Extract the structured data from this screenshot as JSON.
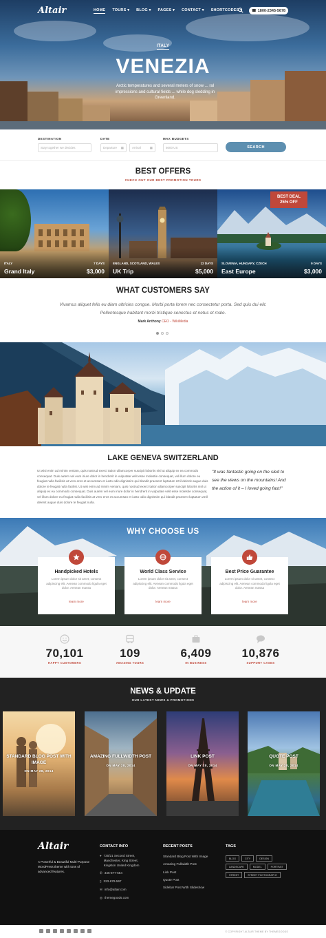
{
  "brand": {
    "logo": "Altair"
  },
  "nav": {
    "items": [
      "HOME",
      "TOURS ▾",
      "BLOG ▾",
      "PAGES ▾",
      "CONTACT ▾",
      "SHORTCODES ▾"
    ],
    "phone": "1800-2345-5678"
  },
  "hero": {
    "tag": "ITALY",
    "title": "VENEZIA",
    "subtitle": "Arctic temperatures and several meters of snow ... ral impressions and cultural fields ... while dog sledding in Greenland."
  },
  "search": {
    "destination_label": "DESTINATION",
    "destination_placeholder": "Stay together we decides",
    "date_label": "DATE",
    "date_from": "Departure",
    "date_to": "Arrival",
    "budget_label": "MAX BUDGETS",
    "budget_placeholder": "5000 US",
    "button": "SEARCH"
  },
  "offers": {
    "title": "BEST OFFERS",
    "subtitle": "CHECK OUT OUR BEST PROMOTION TOURS",
    "items": [
      {
        "region": "ITALY",
        "name": "Grand Italy",
        "days": "7 DAYS",
        "price": "$3,000"
      },
      {
        "region": "ENGLAND, SCOTLAND, WALES",
        "name": "UK Trip",
        "days": "12 DAYS",
        "price": "$5,000"
      },
      {
        "region": "SLOVENIA, HUNGARY, CZECH",
        "name": "East Europe",
        "days": "9 DAYS",
        "price": "$3,000"
      }
    ],
    "deal_badge_line1": "BEST DEAL",
    "deal_badge_line2": "25% OFF"
  },
  "testimonial": {
    "title": "WHAT CUSTOMERS SAY",
    "quote": "Vivamus aliquet felis eu diam ultricies congue. Morbi porta lorem nec consectetur porta. Sed quis dui elit. Pellentesque habitant morbi tristique senectus et netus et male.",
    "author": "Mark Anthony",
    "role": "CEO - WikiMedia"
  },
  "geneva": {
    "title": "LAKE GENEVA SWITZERLAND",
    "body": "Ut wisi enim ad minim veniam, quis nostrud exerci tation ullamcorper suscipit lobortis nisl ut aliquip ex ea commodo consequat. Duis autem vel eum iriure dolor in hendrerit in vulputate velit esse molestie consequat, vel illum dolore eu feugiat nulla facilisis at vero eros et accumsan et iusto odio dignissim qui blandit praesent luptatum zzril delenit augue duis dolore te feugait nulla facilisi. Ut wisi enim ad minim veniam, quis nostrud exerci tation ullamcorper suscipit lobortis nisl ut aliquip ex ea commodo consequat. Duis autem vel eum iriure dolor in hendrerit in vulputate velit esse molestie consequat, vel illum dolore eu feugiat nulla facilisis at vero eros et accumsan et iusto odio dignissim qui blandit praesent luptatum zzril delenit augue duis dolore te feugait nulla.",
    "quote": "\"It was fantastic going on the sled to see the views on the mountains! And the action of it – I loved going fast!\""
  },
  "why": {
    "title": "WHY CHOOSE US",
    "cards": [
      {
        "title": "Handpicked Hotels",
        "text": "Lorem ipsum dolor sit amet, consect adipiscing elit. Aenean commodo ligula eget dolor. Aenean massa",
        "more": "learn more"
      },
      {
        "title": "World Class Service",
        "text": "Lorem ipsum dolor sit amet, consect adipiscing elit. Aenean commodo ligula eget dolor. Aenean massa",
        "more": "learn more"
      },
      {
        "title": "Best Price Guarantee",
        "text": "Lorem ipsum dolor sit amet, consect adipiscing elit. Aenean commodo ligula eget dolor. Aenean massa",
        "more": "learn more"
      }
    ]
  },
  "stats": [
    {
      "num": "70,101",
      "label": "HAPPY CUSTOMERS",
      "icon": "smile-icon"
    },
    {
      "num": "109",
      "label": "AMAZING TOURS",
      "icon": "bus-icon"
    },
    {
      "num": "6,409",
      "label": "IN BUSINESS",
      "icon": "briefcase-icon"
    },
    {
      "num": "10,876",
      "label": "SUPPORT CASES",
      "icon": "chat-icon"
    }
  ],
  "news": {
    "title": "NEWS & UPDATE",
    "subtitle": "OUR LATEST NEWS & PROMOTIONS",
    "posts": [
      {
        "title": "STANDARD BLOG POST WITH IMAGE",
        "date": "ON MAY 28, 2014"
      },
      {
        "title": "AMAZING FULLWIDTH POST",
        "date": "ON MAY 28, 2014"
      },
      {
        "title": "LINK POST",
        "date": "ON MAY 28, 2014"
      },
      {
        "title": "QUOTE POST",
        "date": "ON MAY 28, 2014"
      }
    ]
  },
  "footer": {
    "logo": "Altair",
    "about": "A Powerful & Beautiful Multi-Purpose WordPress theme with tons of advanced features.",
    "contact_title": "CONTACT INFO",
    "address": "730/21 Second Street, Manchester, King Street, Kingston United Kingdom",
    "phone1": "345-877-554",
    "phone2": "323-678-567",
    "email": "info@altair.com",
    "web": "themegoods.com",
    "posts_title": "RECENT POSTS",
    "posts": [
      "Standard Blog Post With Image",
      "Amazing Fullwidth Post",
      "Link Post",
      "Quote Post",
      "Sidebar Post With Slideshow"
    ],
    "tags_title": "TAGS",
    "tags": [
      "BLOG",
      "CITY",
      "DESIGN",
      "LANDSCAPE",
      "MODEL",
      "PORTRAIT",
      "STREET",
      "STREET PHOTOGRAPHY"
    ],
    "copyright": "© COPYRIGHT ALTAIR THEME BY THEMEGOODS"
  },
  "colors": {
    "accent": "#c0483a",
    "button": "#5d8fb0",
    "dark": "#222222"
  }
}
